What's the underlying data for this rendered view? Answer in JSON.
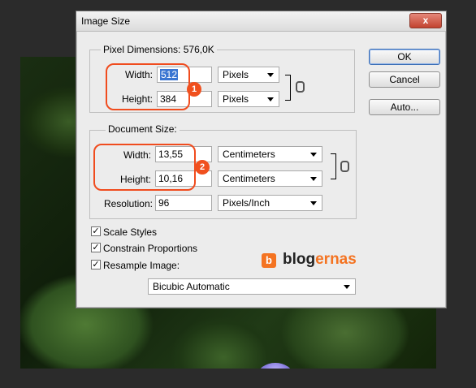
{
  "dialog": {
    "title": "Image Size",
    "close_symbol": "x"
  },
  "pixel_dimensions": {
    "legend": "Pixel Dimensions:",
    "size_value": "576,0K",
    "width_label": "Width:",
    "width_value": "512",
    "width_unit": "Pixels",
    "height_label": "Height:",
    "height_value": "384",
    "height_unit": "Pixels"
  },
  "document_size": {
    "legend": "Document Size:",
    "width_label": "Width:",
    "width_value": "13,55",
    "width_unit": "Centimeters",
    "height_label": "Height:",
    "height_value": "10,16",
    "height_unit": "Centimeters",
    "resolution_label": "Resolution:",
    "resolution_value": "96",
    "resolution_unit": "Pixels/Inch"
  },
  "options": {
    "scale_styles": {
      "label": "Scale Styles",
      "checked": true
    },
    "constrain_proportions": {
      "label": "Constrain Proportions",
      "checked": true
    },
    "resample_image": {
      "label": "Resample Image:",
      "checked": true
    },
    "resample_method": "Bicubic Automatic"
  },
  "buttons": {
    "ok": "OK",
    "cancel": "Cancel",
    "auto": "Auto..."
  },
  "annotations": {
    "badge1": "1",
    "badge2": "2",
    "accent_color": "#f04c1e"
  },
  "watermark": {
    "icon_letter": "b",
    "text_part1": "blog",
    "text_part2": "ernas",
    "brand_color": "#f47321"
  },
  "icons": [
    "link-chain-icon",
    "checkbox-checked-icon",
    "dropdown-arrow-icon",
    "close-icon"
  ]
}
